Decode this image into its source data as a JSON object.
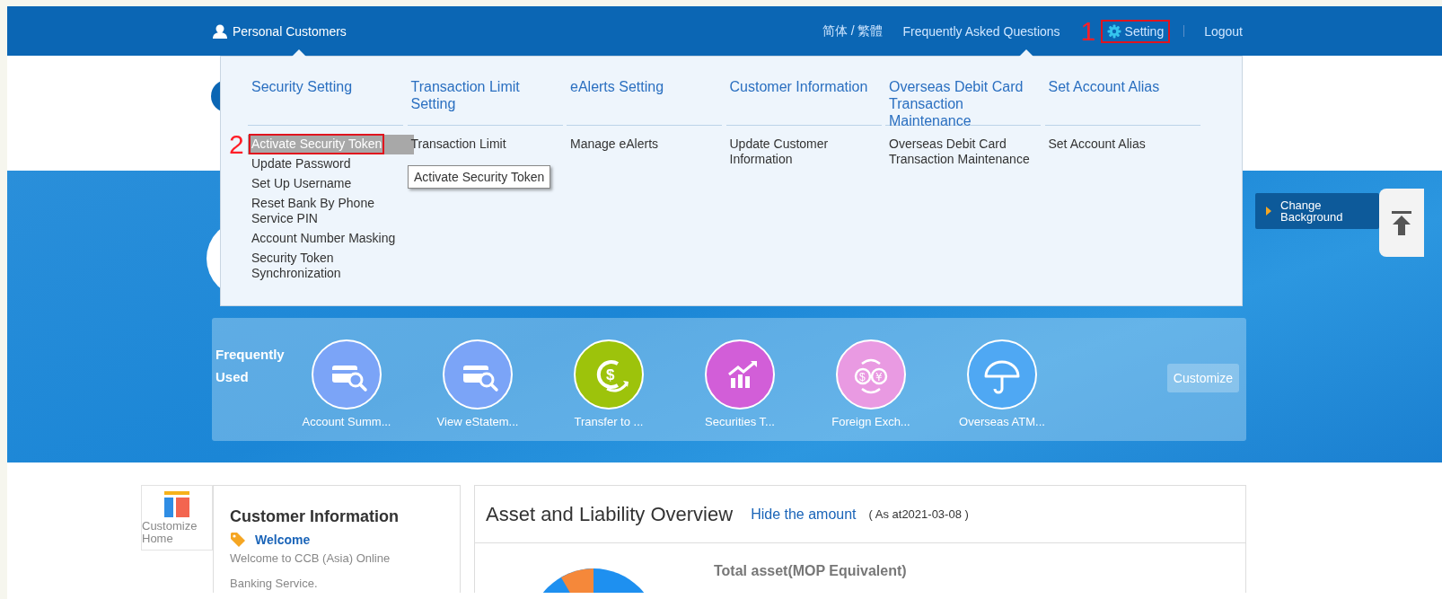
{
  "topbar": {
    "user_label": "Personal Customers",
    "links": [
      {
        "label": "简体 / 繁體",
        "kind": "link"
      },
      {
        "label": "Frequently Asked Questions",
        "kind": "link"
      },
      {
        "label": "Setting",
        "kind": "setting",
        "callout": "1"
      },
      {
        "label": "Logout",
        "kind": "link"
      }
    ]
  },
  "menu": {
    "columns": [
      {
        "header": "Security Setting",
        "items": [
          {
            "label": "Activate Security Token",
            "hovered": true,
            "callout": "2"
          },
          {
            "label": "Update Password",
            "hovered": false
          },
          {
            "label": "Set Up Username",
            "hovered": false
          },
          {
            "label": "Reset Bank By Phone Service PIN",
            "hovered": false
          },
          {
            "label": "Account Number Masking",
            "hovered": false
          },
          {
            "label": "Security Token Synchronization",
            "hovered": false
          }
        ]
      },
      {
        "header": "Transaction Limit Setting",
        "items": [
          {
            "label": "Transaction Limit",
            "hovered": false
          }
        ]
      },
      {
        "header": "eAlerts Setting",
        "items": [
          {
            "label": "Manage eAlerts",
            "hovered": false
          }
        ]
      },
      {
        "header": "Customer Information",
        "items": [
          {
            "label": "Update Customer Information",
            "hovered": false
          }
        ]
      },
      {
        "header": "Overseas Debit Card Transaction Maintenance",
        "items": [
          {
            "label": "Overseas Debit Card Transaction Maintenance",
            "hovered": false
          }
        ]
      },
      {
        "header": "Set Account Alias",
        "items": [
          {
            "label": "Set Account Alias",
            "hovered": false
          }
        ]
      }
    ],
    "tooltip": "Activate Security Token"
  },
  "banner": {
    "change_background": "Change Background"
  },
  "frequently_used": {
    "title": "Frequently Used",
    "items": [
      {
        "label": "Account Summ...",
        "kind": "card",
        "color": "#7ba4f7"
      },
      {
        "label": "View eStatem...",
        "kind": "card",
        "color": "#7ba4f7"
      },
      {
        "label": "Transfer to ...",
        "kind": "transfer",
        "color": "#9dc30b",
        "symbols": [
          "$"
        ]
      },
      {
        "label": "Securities T...",
        "kind": "chart",
        "color": "#d25ed8"
      },
      {
        "label": "Foreign Exch...",
        "kind": "exchange",
        "color": "#e99ae2",
        "symbols": [
          "$",
          "¥"
        ]
      },
      {
        "label": "Overseas ATM...",
        "kind": "umbrella",
        "color": "#4fa8f3"
      }
    ],
    "customize_button": "Customize"
  },
  "customize_home": "Customize Home",
  "customer_info": {
    "title": "Customer Information",
    "welcome": "Welcome",
    "message": "Welcome to CCB (Asia) Online Banking Service."
  },
  "asset_overview": {
    "title": "Asset and Liability Overview",
    "hide_link": "Hide the amount",
    "as_at": "( As at2021-03-08 )",
    "total_asset_label": "Total asset(MOP Equivalent)"
  }
}
